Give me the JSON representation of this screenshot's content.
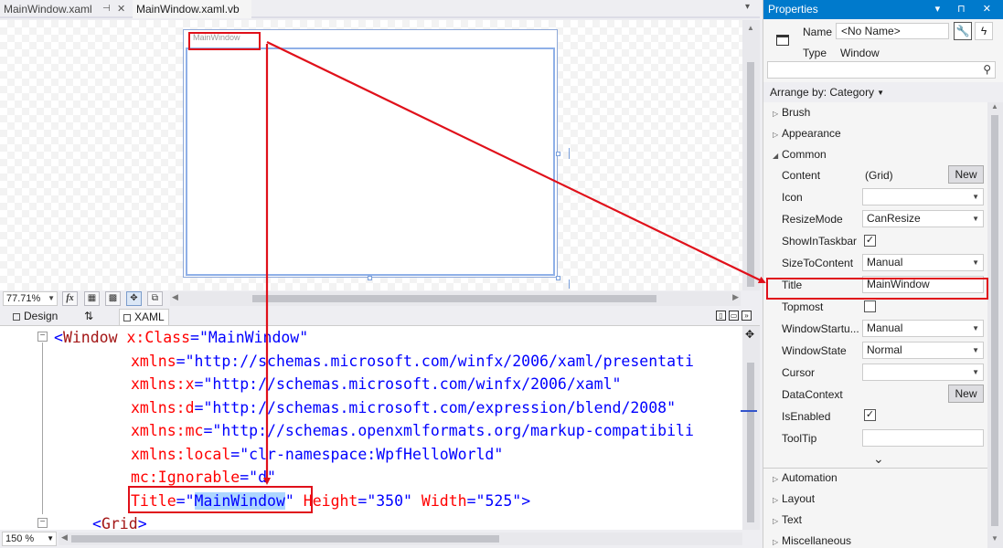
{
  "tabs": {
    "file1": "MainWindow.xaml",
    "file2": "MainWindow.xaml.vb"
  },
  "designer": {
    "window_title": "MainWindow"
  },
  "zoom_toolbar": {
    "zoom": "77.71%",
    "fx": "fx"
  },
  "split_tabs": {
    "design": "Design",
    "swap": "⇅",
    "xaml": "XAML"
  },
  "code": {
    "l1": {
      "open": "<",
      "tag": "Window",
      "attr": "x:Class",
      "eq": "=",
      "val": "\"MainWindow\""
    },
    "l2": {
      "attr": "xmlns",
      "eq": "=",
      "val": "\"http://schemas.microsoft.com/winfx/2006/xaml/presentati"
    },
    "l3": {
      "attr": "xmlns:x",
      "eq": "=",
      "val": "\"http://schemas.microsoft.com/winfx/2006/xaml\""
    },
    "l4": {
      "attr": "xmlns:d",
      "eq": "=",
      "val": "\"http://schemas.microsoft.com/expression/blend/2008\""
    },
    "l5": {
      "attr": "xmlns:mc",
      "eq": "=",
      "val": "\"http://schemas.openxmlformats.org/markup-compatibili"
    },
    "l6": {
      "attr": "xmlns:local",
      "eq": "=",
      "val": "\"clr-namespace:WpfHelloWorld\""
    },
    "l7": {
      "attr": "mc:Ignorable",
      "eq": "=",
      "val": "\"d\""
    },
    "l8": {
      "attr1": "Title",
      "eq1": "=",
      "val1a": "\"",
      "val1b": "MainWindow",
      "val1c": "\"",
      "attr2": "Height",
      "eq2": "=",
      "val2": "\"350\"",
      "attr3": "Width",
      "eq3": "=",
      "val3": "\"525\"",
      "close": ">"
    },
    "l9": {
      "open": "<",
      "tag": "Grid",
      "close": ">"
    }
  },
  "editor_bottom": {
    "zoom": "150 %"
  },
  "properties": {
    "title": "Properties",
    "title_buttons": "▾ ⊓ ✕",
    "name_label": "Name",
    "name_value": "<No Name>",
    "type_label": "Type",
    "type_value": "Window",
    "arrange_by": "Arrange by: Category",
    "categories": {
      "brush": "Brush",
      "appearance": "Appearance",
      "common": "Common",
      "automation": "Automation",
      "layout": "Layout",
      "text": "Text",
      "misc": "Miscellaneous"
    },
    "rows": {
      "content": {
        "label": "Content",
        "value": "(Grid)",
        "button": "New"
      },
      "icon": {
        "label": "Icon",
        "value": ""
      },
      "resizemode": {
        "label": "ResizeMode",
        "value": "CanResize"
      },
      "showintaskbar": {
        "label": "ShowInTaskbar",
        "checked": "✓"
      },
      "sizetocontent": {
        "label": "SizeToContent",
        "value": "Manual"
      },
      "title": {
        "label": "Title",
        "value": "MainWindow"
      },
      "topmost": {
        "label": "Topmost",
        "checked": ""
      },
      "windowstartup": {
        "label": "WindowStartu...",
        "value": "Manual"
      },
      "windowstate": {
        "label": "WindowState",
        "value": "Normal"
      },
      "cursor": {
        "label": "Cursor",
        "value": ""
      },
      "datacontext": {
        "label": "DataContext",
        "button": "New"
      },
      "isenabled": {
        "label": "IsEnabled",
        "checked": "✓"
      },
      "tooltip": {
        "label": "ToolTip",
        "value": ""
      }
    }
  },
  "colors": {
    "annotation": "#e0101a",
    "accent": "#007acc",
    "xaml_tag": "#a31515",
    "xaml_attr": "#ff0000",
    "xaml_value": "#0000ff"
  }
}
